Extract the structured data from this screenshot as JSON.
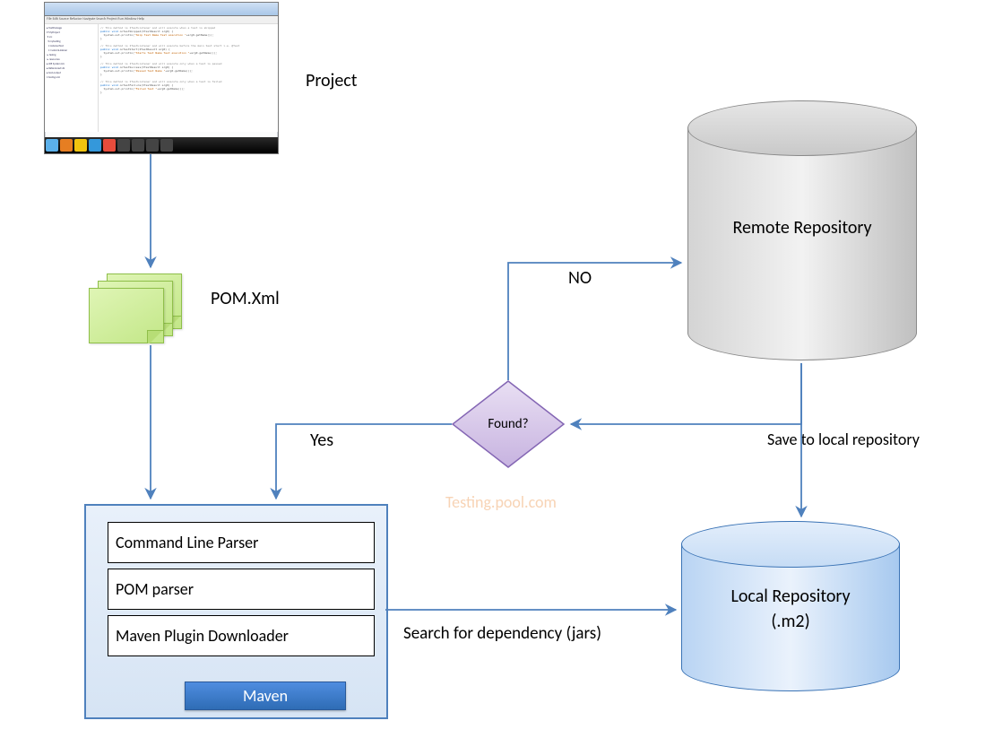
{
  "labels": {
    "project": "Project",
    "pom": "POM.Xml",
    "found": "Found?",
    "yes": "Yes",
    "no": "NO",
    "search": "Search for dependency (jars)",
    "save": "Save to local repository",
    "watermark": "Testing.pool.com"
  },
  "maven": {
    "items": [
      "Command Line Parser",
      "POM parser",
      "Maven Plugin Downloader"
    ],
    "badge": "Maven"
  },
  "repos": {
    "remote": "Remote Repository",
    "local_line1": "Local Repository",
    "local_line2": "(.m2)"
  },
  "ide": {
    "menu": "File Edit Source Refactor Navigate Search Project Run Window Help"
  }
}
